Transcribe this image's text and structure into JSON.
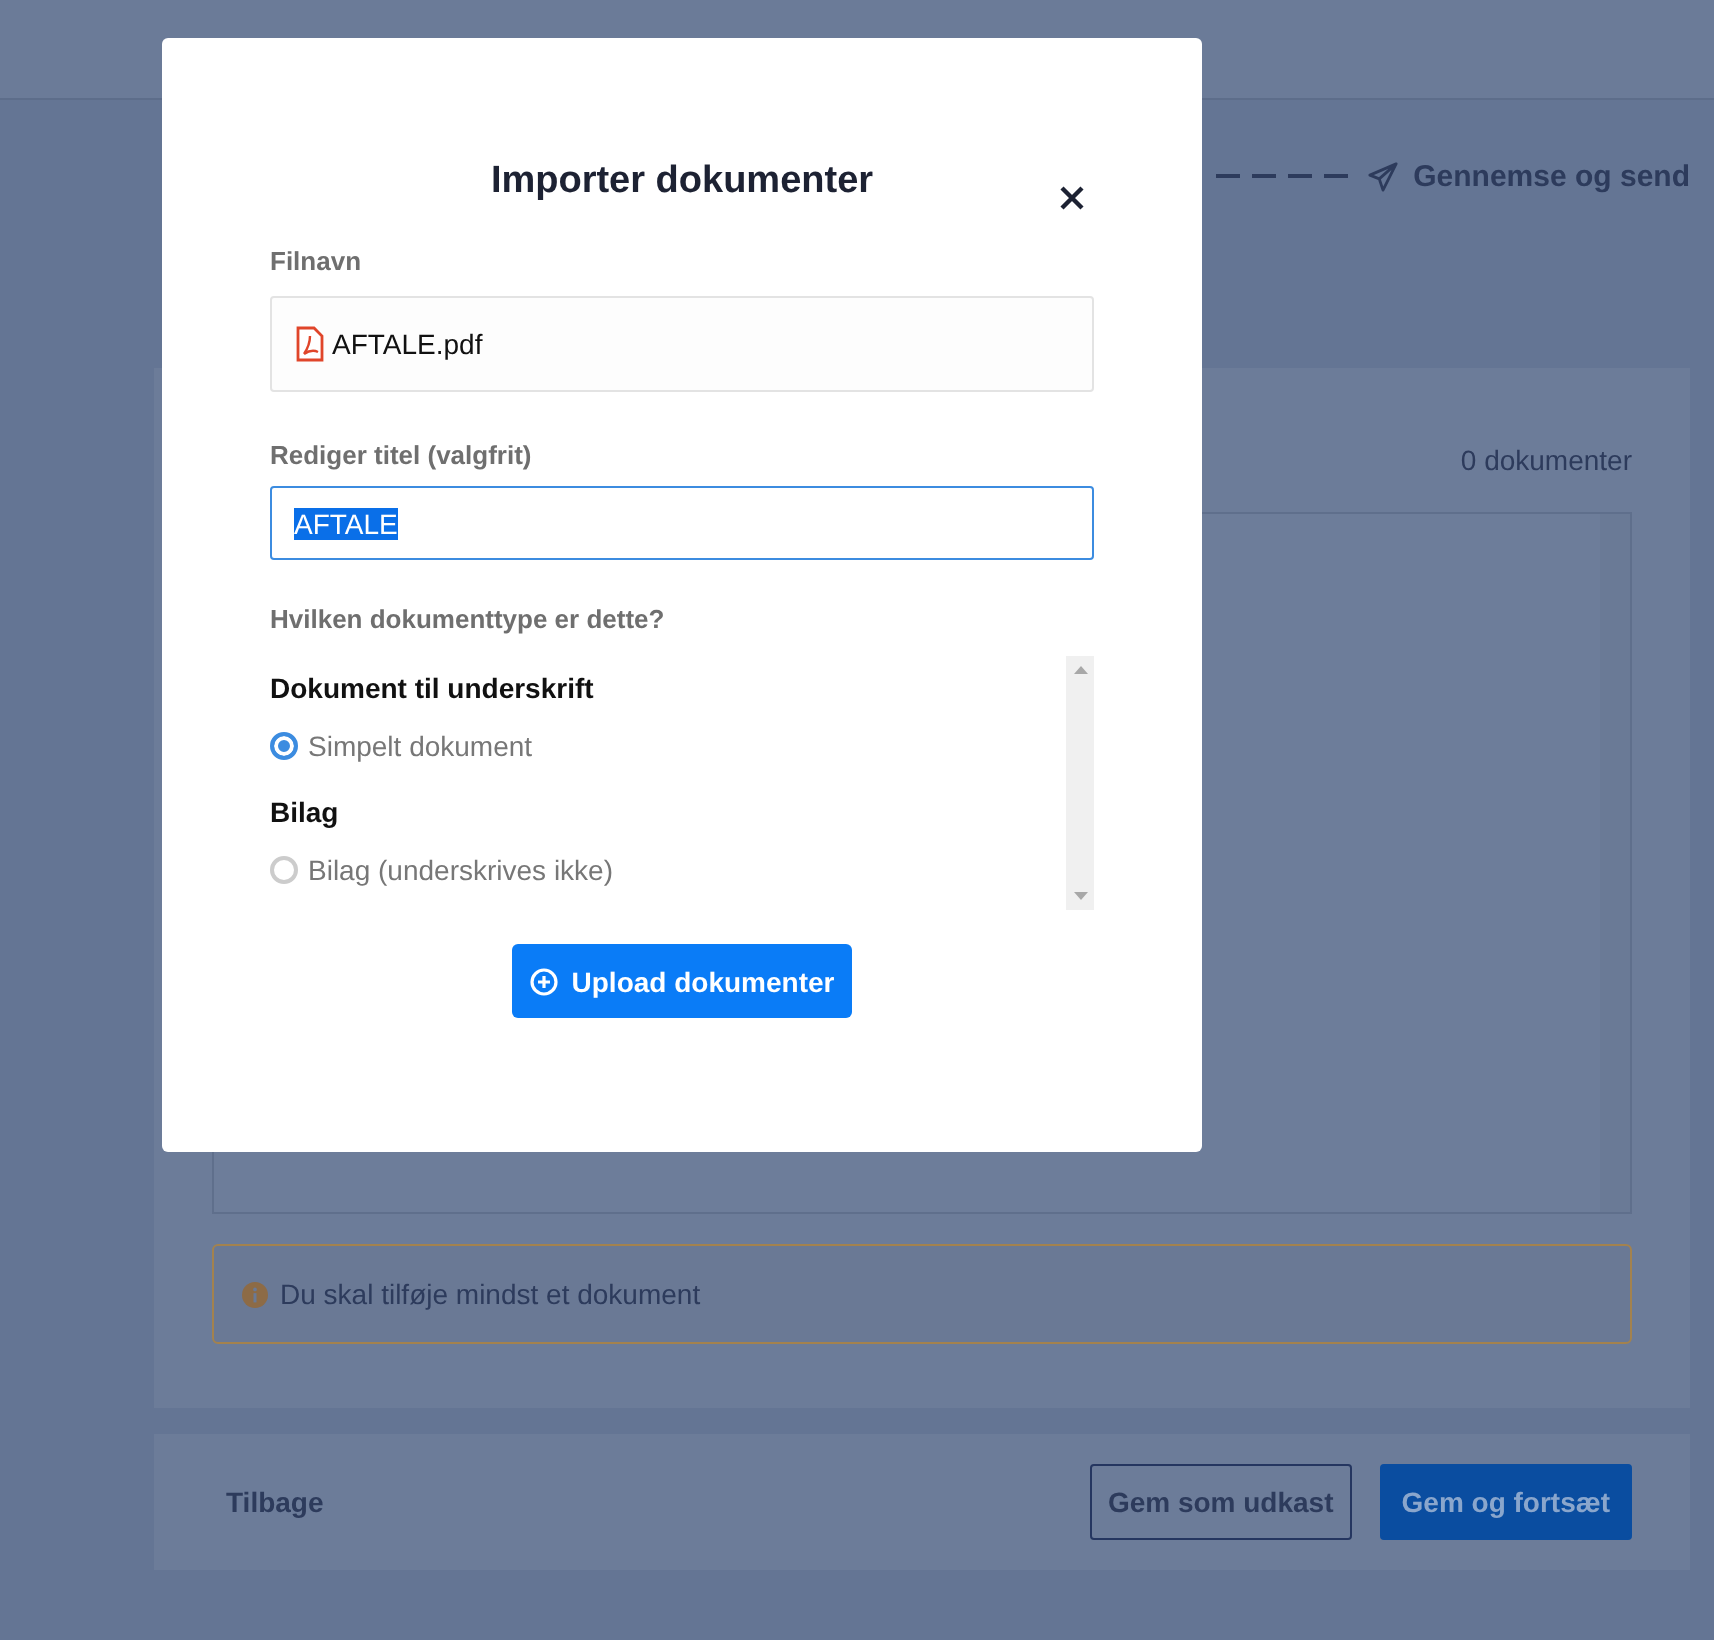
{
  "stepper": {
    "last_step": "Gennemse og send"
  },
  "documents_panel": {
    "count": "0 dokumenter",
    "warning": "Du skal tilføje mindst et dokument"
  },
  "footer": {
    "back": "Tilbage",
    "buttons": [
      {
        "label": "Gem som udkast",
        "kind": "outline"
      },
      {
        "label": "Gem og fortsæt",
        "kind": "primary"
      }
    ]
  },
  "modal": {
    "title": "Importer dokumenter",
    "filename": {
      "label": "Filnavn",
      "value": "AFTALE.pdf"
    },
    "title_field": {
      "label": "Rediger titel (valgfrit)",
      "value": "AFTALE",
      "text_selected": true
    },
    "question": "Hvilken dokumenttype er dette?",
    "groups": [
      {
        "heading": "Dokument til underskrift",
        "options": [
          {
            "label": "Simpelt dokument",
            "selected": true
          }
        ]
      },
      {
        "heading": "Bilag",
        "options": [
          {
            "label": "Bilag (underskrives ikke)",
            "selected": false
          }
        ]
      }
    ],
    "upload_button": "Upload dokumenter"
  }
}
